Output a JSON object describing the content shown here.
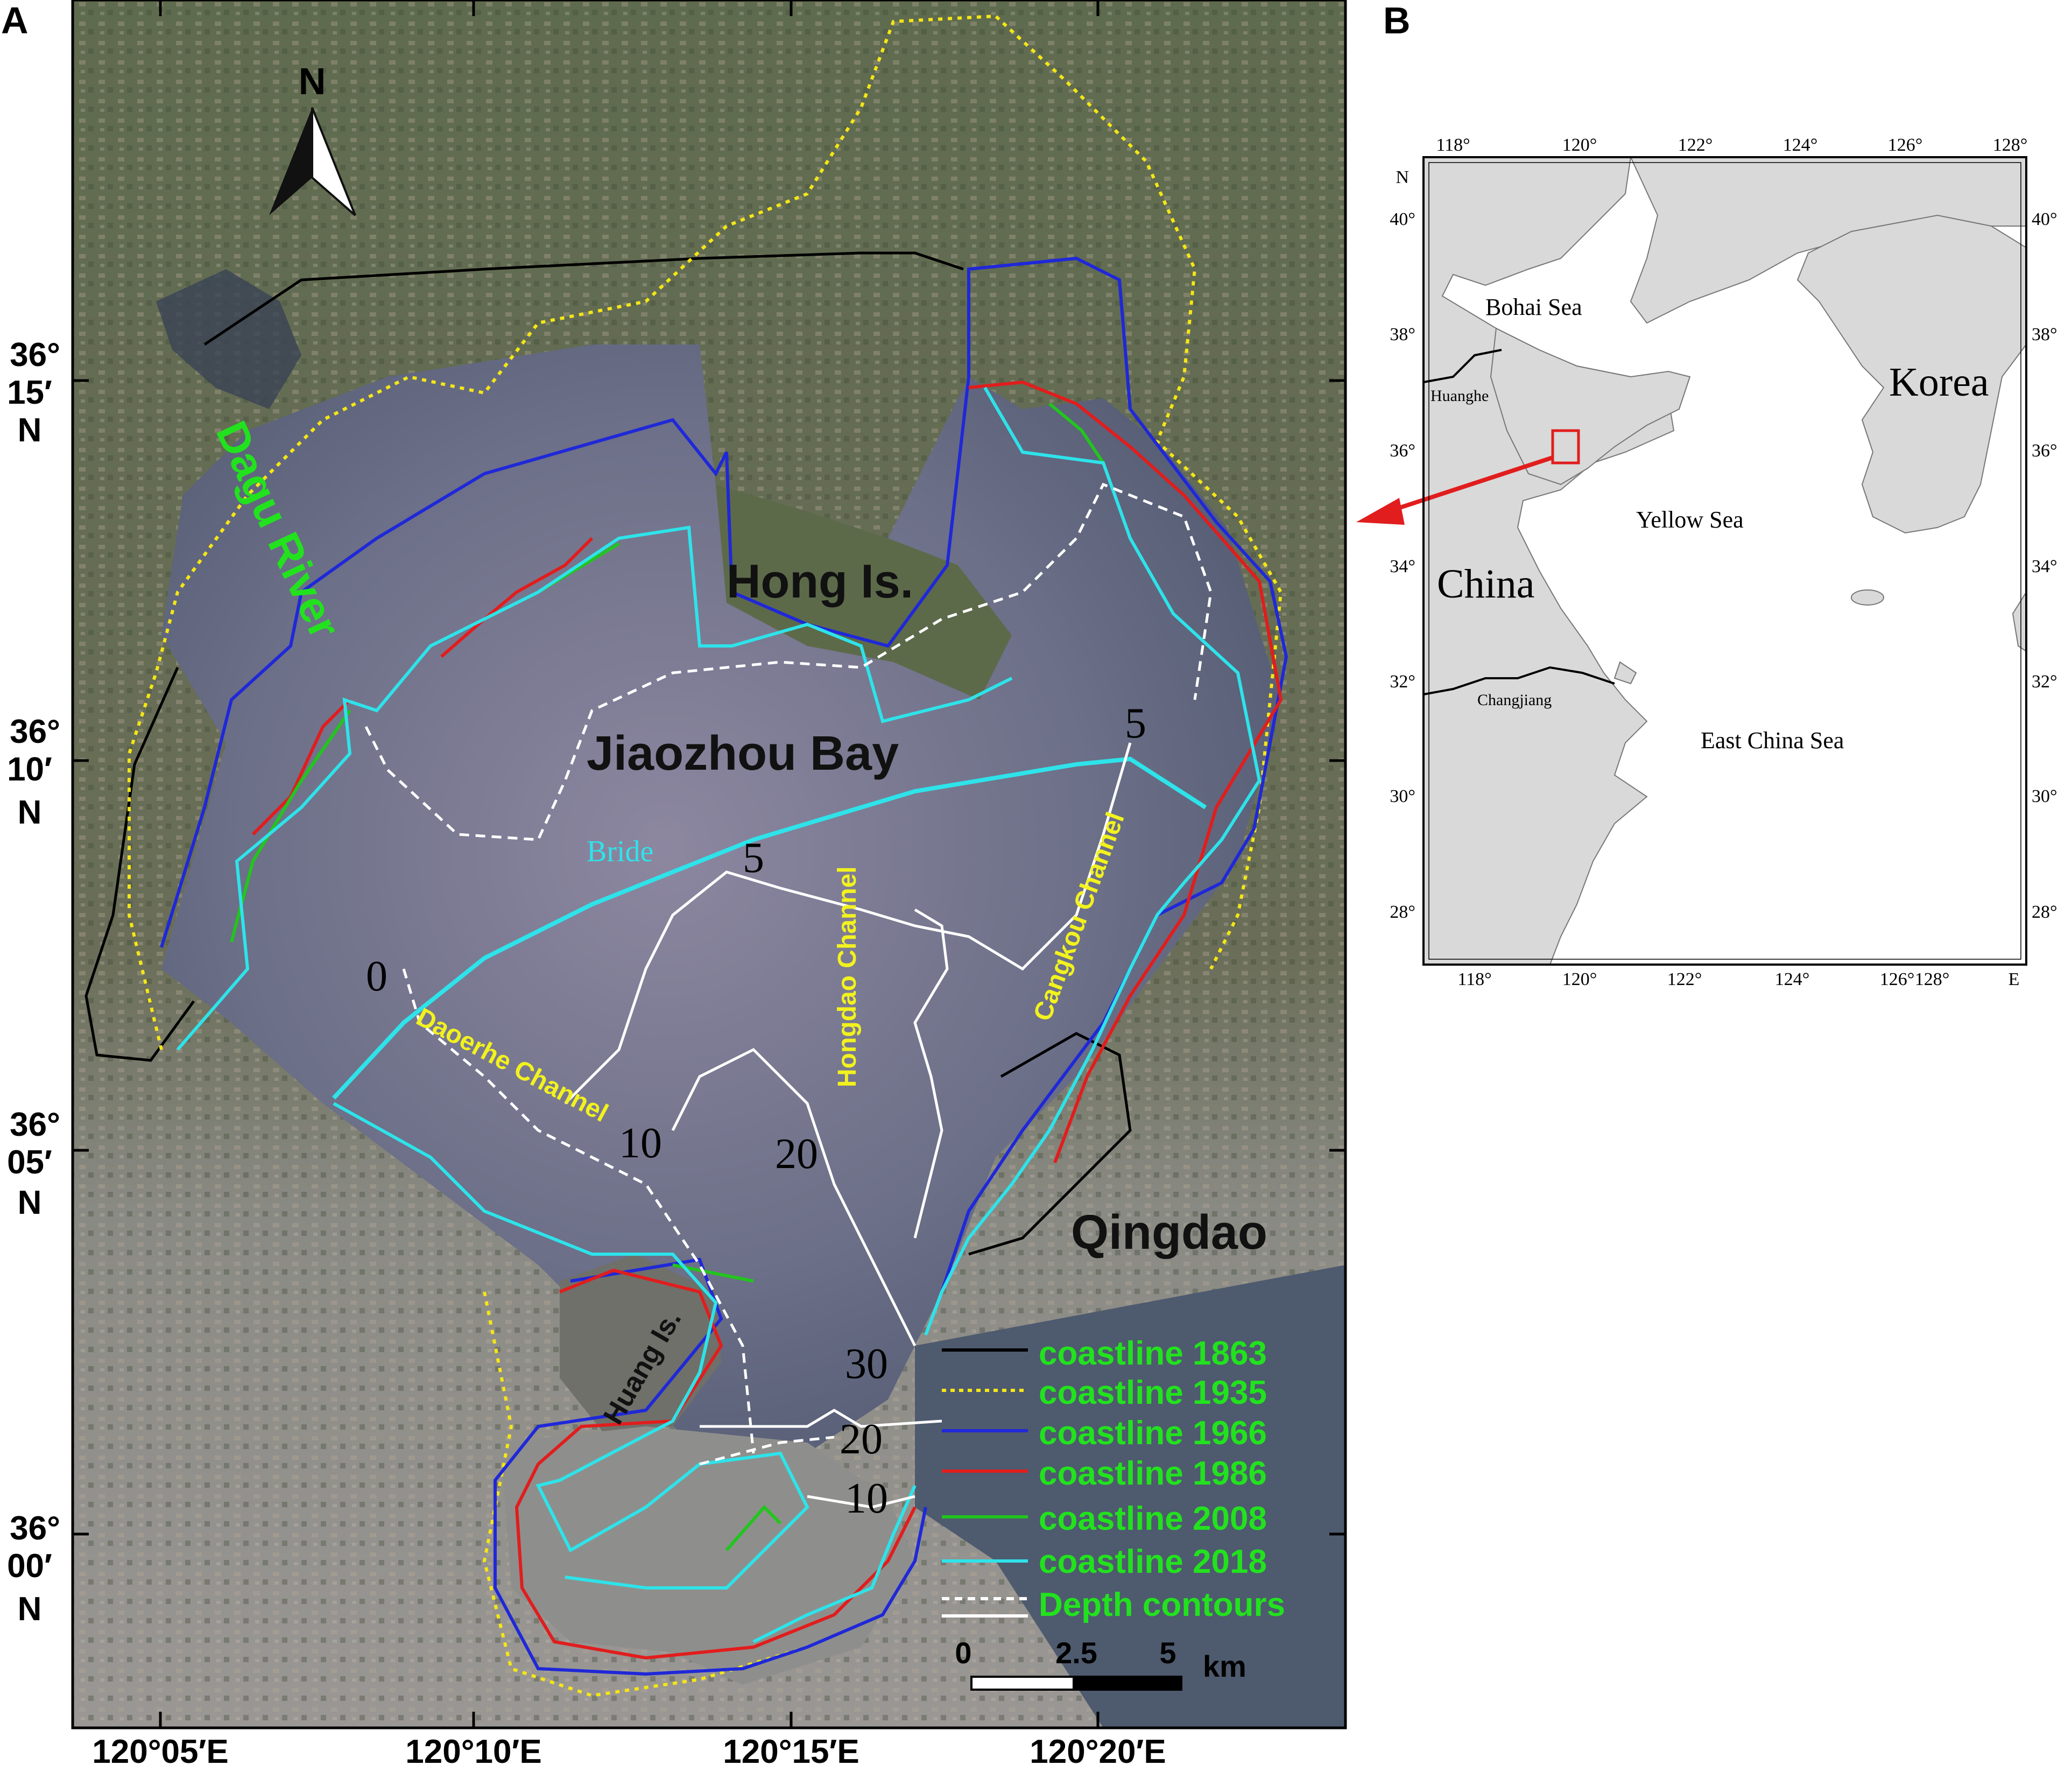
{
  "panels": {
    "a_letter": "A",
    "b_letter": "B"
  },
  "map_a": {
    "north_label": "N",
    "place_names": {
      "river": "Dagu River",
      "hong": "Hong Is.",
      "bay": "Jiaozhou Bay",
      "bridge": "Bride",
      "qingdao": "Qingdao",
      "huang": "Huang Is."
    },
    "channels": {
      "daoerhe": "Daoerhe Channel",
      "hongdao": "Hongdao Channel",
      "cangkou": "Cangkou Channel"
    },
    "depth_labels": [
      "0",
      "5",
      "5",
      "10",
      "20",
      "30",
      "20",
      "10"
    ],
    "lat_labels": [
      {
        "deg": "36°",
        "min": "15′",
        "hemi": "N"
      },
      {
        "deg": "36°",
        "min": "10′",
        "hemi": "N"
      },
      {
        "deg": "36°",
        "min": "05′",
        "hemi": "N"
      },
      {
        "deg": "36°",
        "min": "00′",
        "hemi": "N"
      }
    ],
    "lon_labels": [
      "120°05′E",
      "120°10′E",
      "120°15′E",
      "120°20′E"
    ],
    "legend": [
      {
        "label": "coastline 1863",
        "color": "#000000",
        "style": "solid"
      },
      {
        "label": "coastline 1935",
        "color": "#f5e616",
        "style": "dotted"
      },
      {
        "label": "coastline 1966",
        "color": "#1f28d8",
        "style": "solid"
      },
      {
        "label": "coastline 1986",
        "color": "#e11d1d",
        "style": "solid"
      },
      {
        "label": "coastline 2008",
        "color": "#22c51e",
        "style": "solid"
      },
      {
        "label": "coastline 2018",
        "color": "#2ee3ea",
        "style": "solid"
      },
      {
        "label": "Depth contours",
        "color": "#ffffff",
        "style": "dashed"
      }
    ],
    "scale_bar": {
      "ticks": [
        "0",
        "2.5",
        "5"
      ],
      "unit": "km"
    },
    "colors": {
      "legend_text": "#22e21e",
      "river_text": "#22e21e",
      "channel_text": "#f2f21e",
      "bridge_text": "#2ee3ea"
    }
  },
  "map_b": {
    "top_lon": [
      "118°",
      "120°",
      "122°",
      "124°",
      "126°",
      "128°"
    ],
    "bottom_lon": [
      "118°",
      "120°",
      "122°",
      "124°",
      "126°",
      "128°"
    ],
    "left_lat": [
      "40°",
      "38°",
      "36°",
      "34°",
      "32°",
      "30°",
      "28°"
    ],
    "right_lat": [
      "40°",
      "38°",
      "36°",
      "34°",
      "32°",
      "30°",
      "28°"
    ],
    "corner_n": "N",
    "corner_e": "E",
    "labels": {
      "bohai": "Bohai Sea",
      "huanghe": "Huanghe",
      "korea": "Korea",
      "yellow": "Yellow Sea",
      "china": "China",
      "changjiang": "Changjiang",
      "east_china": "East China Sea"
    },
    "colors": {
      "land": "#d9d9d9",
      "locator": "#e11d1d"
    }
  }
}
